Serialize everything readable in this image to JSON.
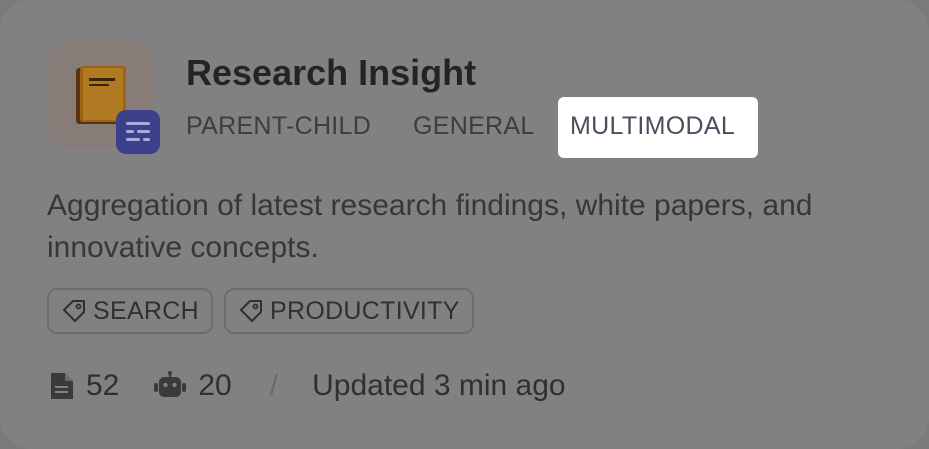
{
  "card": {
    "title": "Research Insight",
    "modes": [
      "PARENT-CHILD",
      "GENERAL",
      "MULTIMODAL"
    ],
    "selected_mode": "MULTIMODAL",
    "description": "Aggregation of latest research findings, white papers, and innovative concepts.",
    "app_icon": "book-icon",
    "badge_icon": "knowledge-base-icon",
    "tags": [
      {
        "icon": "tag-icon",
        "label": "SEARCH"
      },
      {
        "icon": "tag-icon",
        "label": "PRODUCTIVITY"
      }
    ],
    "stats": {
      "documents": "52",
      "documents_icon": "document-icon",
      "apps": "20",
      "apps_icon": "robot-icon",
      "separator": "/",
      "updated": "Updated 3 min ago"
    }
  },
  "colors": {
    "overlay_background": "#818181",
    "highlight": "#ffffff",
    "badge": "#3c3f8a",
    "book": "#c98a1c"
  }
}
